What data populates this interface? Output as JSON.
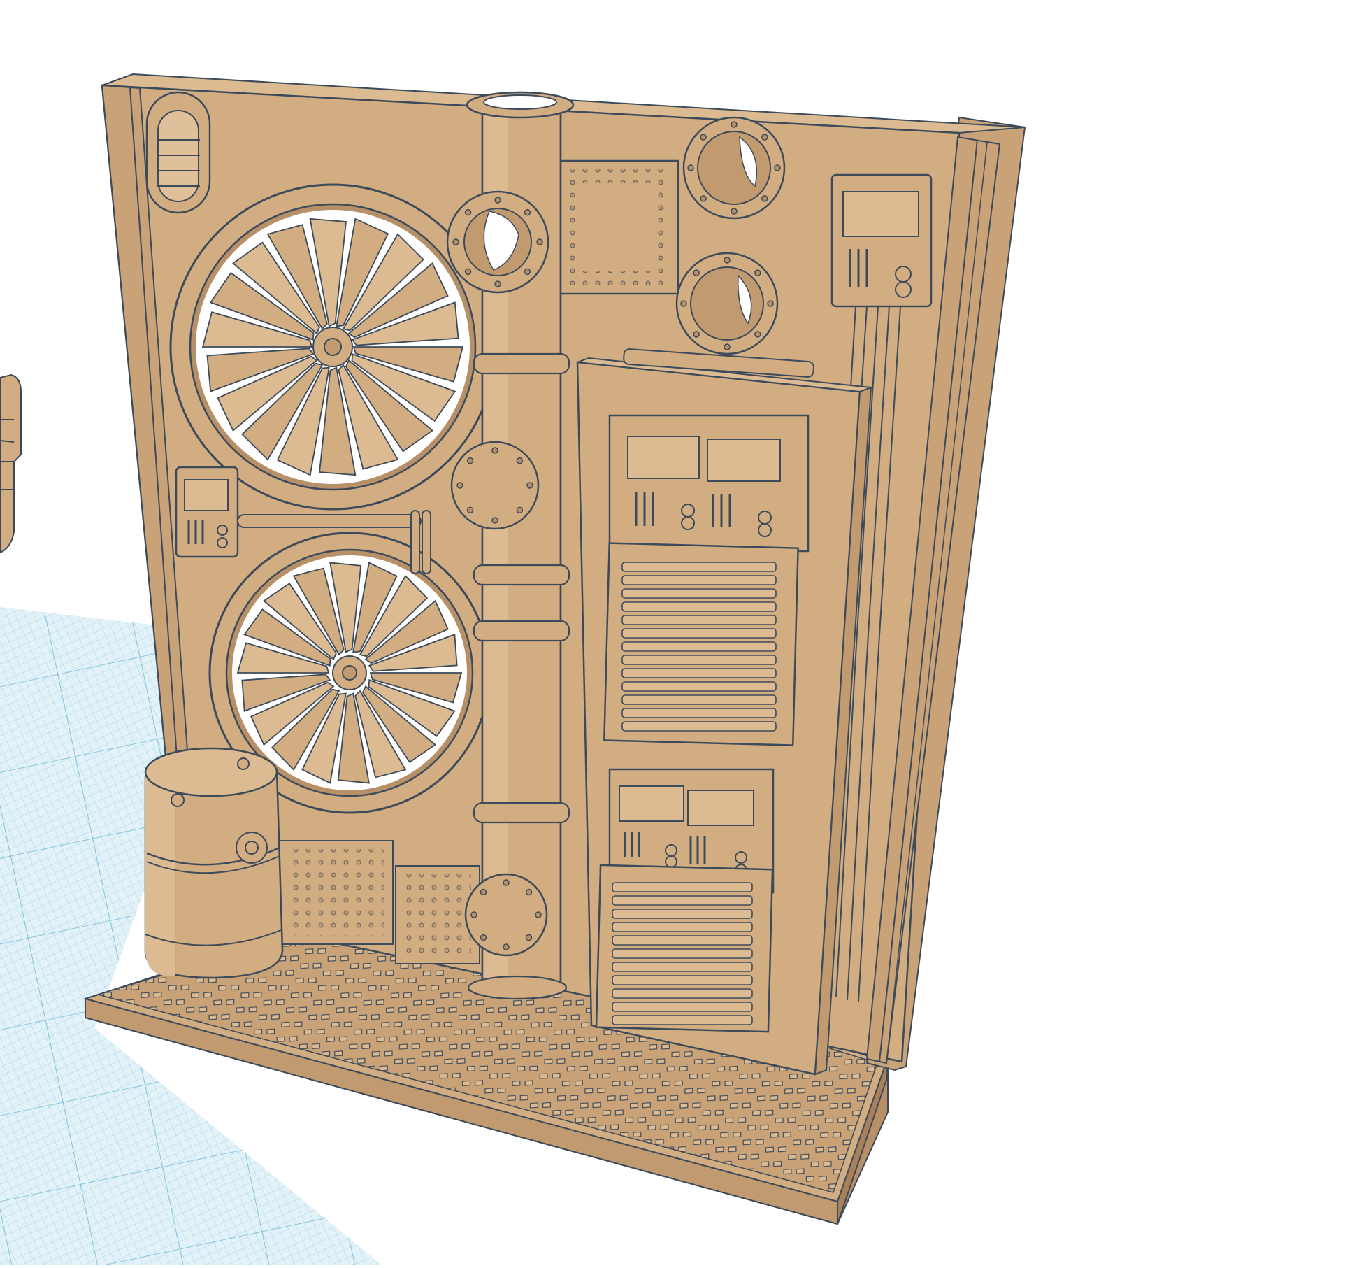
{
  "viewport": {
    "background": "#ffffff",
    "grid_colors": {
      "fill": "#e3f2f8",
      "minor_line": "#a9d6e8",
      "major_line": "#6fb8d6"
    }
  },
  "model": {
    "material_color": "#d2ad82",
    "material_light": "#dcbb93",
    "material_dark": "#b89068",
    "outline_color": "#3c4a5a",
    "parts": [
      "wall-panel",
      "base-plate",
      "fan-top",
      "fan-bottom",
      "vertical-pipe",
      "porthole-upper",
      "porthole-lower",
      "control-box-small-left",
      "control-box-right",
      "electrical-cabinet",
      "vent-grille-upper",
      "vent-grille-lower",
      "oil-barrel",
      "diamond-plate-floor",
      "rivet-panels",
      "conduit-pipes"
    ]
  },
  "offscreen_object": {
    "visible": true,
    "partially_clipped": true
  },
  "icons": {
    "gear": "gear-icon",
    "fan": "fan-icon"
  }
}
